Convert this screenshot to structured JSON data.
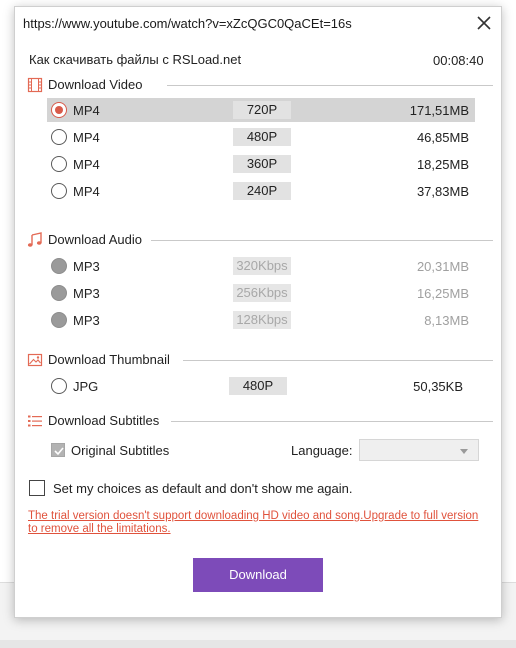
{
  "window": {
    "url": "https://www.youtube.com/watch?v=xZcQGC0QaCEt=16s"
  },
  "video": {
    "title": "Как скачивать файлы с RSLoad.net",
    "duration": "00:08:40"
  },
  "sections": {
    "video": "Download Video",
    "audio": "Download Audio",
    "thumbnail": "Download Thumbnail",
    "subtitles": "Download Subtitles"
  },
  "video_options": [
    {
      "format": "MP4",
      "quality": "720P",
      "size": "171,51MB",
      "selected": true
    },
    {
      "format": "MP4",
      "quality": "480P",
      "size": "46,85MB",
      "selected": false
    },
    {
      "format": "MP4",
      "quality": "360P",
      "size": "18,25MB",
      "selected": false
    },
    {
      "format": "MP4",
      "quality": "240P",
      "size": "37,83MB",
      "selected": false
    }
  ],
  "audio_options": [
    {
      "format": "MP3",
      "quality": "320Kbps",
      "size": "20,31MB",
      "disabled": true
    },
    {
      "format": "MP3",
      "quality": "256Kbps",
      "size": "16,25MB",
      "disabled": true
    },
    {
      "format": "MP3",
      "quality": "128Kbps",
      "size": "8,13MB",
      "disabled": true
    }
  ],
  "thumbnail_option": {
    "format": "JPG",
    "quality": "480P",
    "size": "50,35KB"
  },
  "subtitles": {
    "original_label": "Original Subtitles",
    "original_checked": true,
    "language_label": "Language:",
    "language_value": ""
  },
  "default_choice": {
    "label": "Set my choices as default and don't show me again.",
    "checked": false
  },
  "trial_notice": "The trial version doesn't support downloading HD video and song.Upgrade to full version to remove all the limitations.",
  "download_button": "Download",
  "colors": {
    "accent": "#7d4bb9",
    "radio_selected": "#d85a4a",
    "trial_text": "#e0523c",
    "section_icon": "#e36a55"
  }
}
